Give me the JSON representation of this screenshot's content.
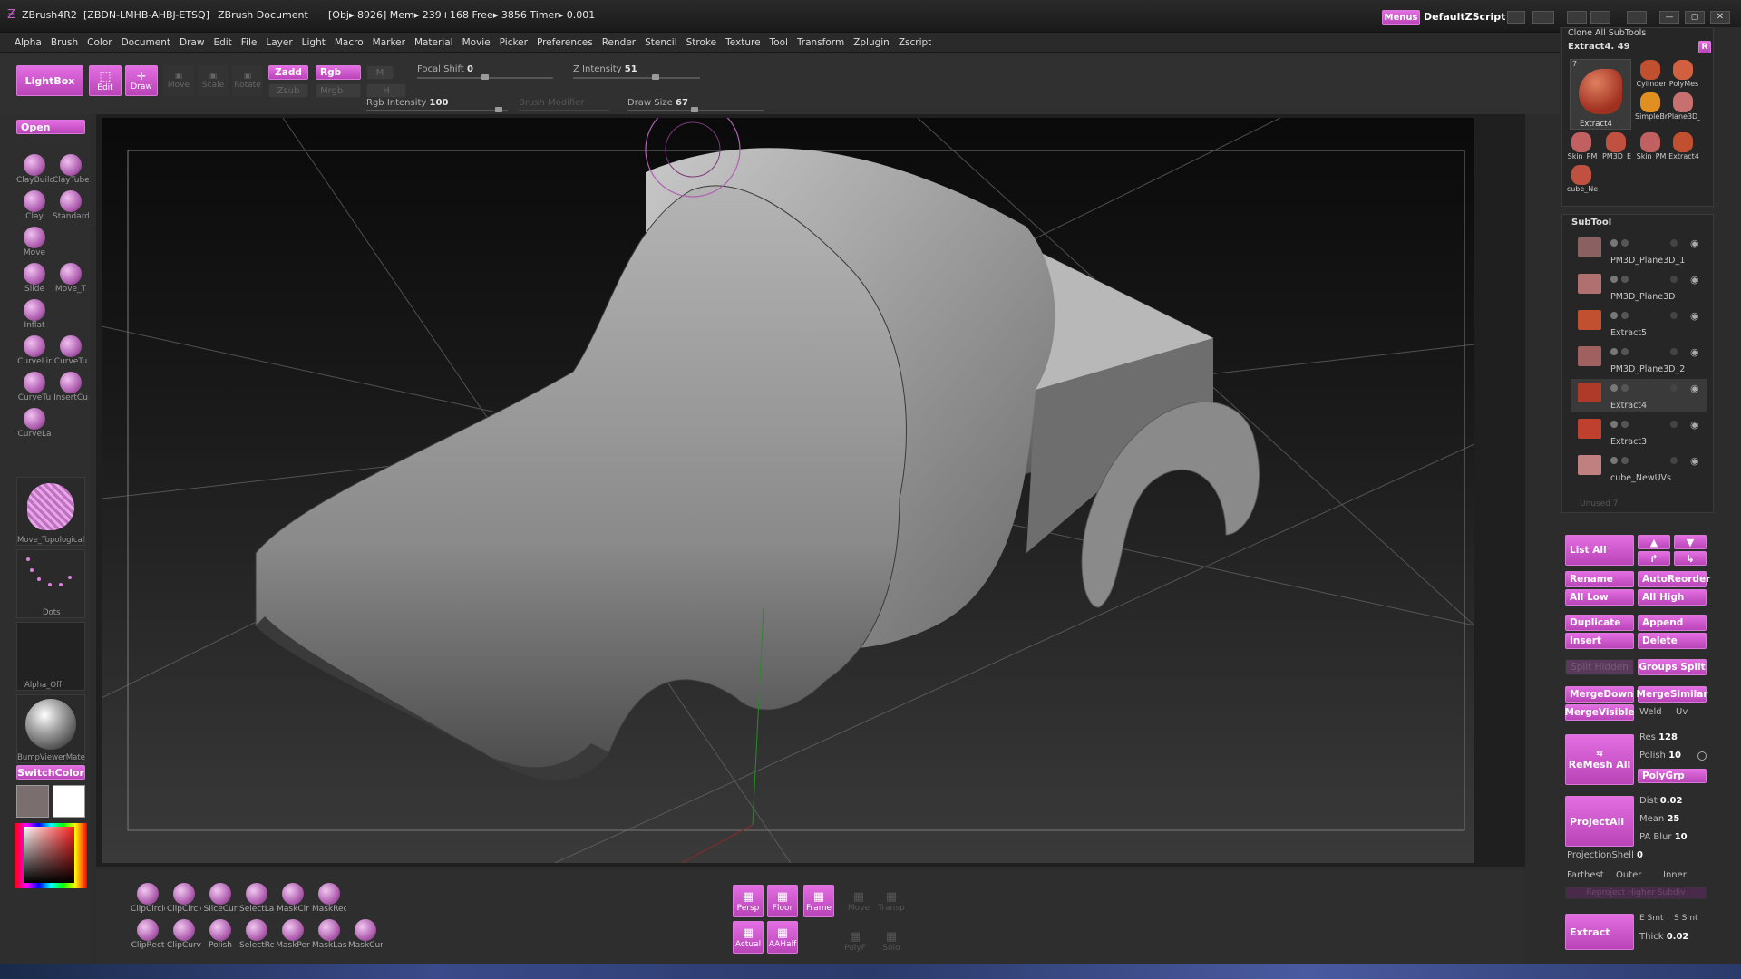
{
  "title_bar": {
    "app": "ZBrush4R2",
    "session": "[ZBDN-LMHB-AHBJ-ETSQ]",
    "document": "ZBrush Document",
    "status": "[Obj▸ 8926] Mem▸ 239+168 Free▸ 3856 Timer▸ 0.001",
    "menus_label": "Menus",
    "script_label": "DefaultZScript"
  },
  "menu": [
    "Alpha",
    "Brush",
    "Color",
    "Document",
    "Draw",
    "Edit",
    "File",
    "Layer",
    "Light",
    "Macro",
    "Marker",
    "Material",
    "Movie",
    "Picker",
    "Preferences",
    "Render",
    "Stencil",
    "Stroke",
    "Texture",
    "Tool",
    "Transform",
    "Zplugin",
    "Zscript"
  ],
  "top_shelf": {
    "lightbox": "LightBox",
    "edit": "Edit",
    "draw": "Draw",
    "move": "Move",
    "scale": "Scale",
    "rotate": "Rotate",
    "zadd": "Zadd",
    "zsub": "Zsub",
    "rgb": "Rgb",
    "mrgb": "Mrgb",
    "m": "M",
    "focal_shift_label": "Focal Shift",
    "focal_shift": "0",
    "z_intensity_label": "Z Intensity",
    "z_intensity": "51",
    "rgb_intensity_label": "Rgb Intensity",
    "rgb_intensity": "100",
    "brush_modifier": "Brush Modifier",
    "draw_size_label": "Draw Size",
    "draw_size": "67"
  },
  "left_shelf": {
    "open": "Open",
    "brushes": [
      "ClayBuild",
      "ClayTube",
      "Clay",
      "Standard",
      "Move",
      "Slide",
      "Move_T",
      "Inflat",
      "CurveLir",
      "CurveTu",
      "CurveTu",
      "InsertCu",
      "CurveLa"
    ],
    "alpha_labels": [
      "Move_Topological",
      "Dots",
      "Alpha_Off",
      "BumpViewerMate"
    ],
    "switch_color": "SwitchColor"
  },
  "right_panel": {
    "clone_all": "Clone All SubTools",
    "extract_value": "Extract4. 49",
    "r_btn": "R",
    "tool_thumbs": [
      "Extract4",
      "Cylinder",
      "PolyMes",
      "SimpleBr",
      "Plane3D_",
      "Skin_PM",
      "PM3D_E",
      "Skin_PM",
      "Extract4",
      "cube_Ne"
    ],
    "tool_count": "7",
    "subtool_title": "SubTool",
    "subtools": [
      "PM3D_Plane3D_1",
      "PM3D_Plane3D",
      "Extract5",
      "PM3D_Plane3D_2",
      "Extract4",
      "Extract3",
      "cube_NewUVs"
    ],
    "unused": "Unused 7",
    "list_all": "List All",
    "rename": "Rename",
    "auto_reorder": "AutoReorder",
    "all_low": "All Low",
    "all_high": "All High",
    "duplicate": "Duplicate",
    "append": "Append",
    "insert": "Insert",
    "delete": "Delete",
    "split_hidden": "Split Hidden",
    "groups_split": "Groups Split",
    "merge_down": "MergeDown",
    "merge_similar": "MergeSimilar",
    "merge_visible": "MergeVisible",
    "weld": "Weld",
    "uv": "Uv",
    "remesh_all": "ReMesh All",
    "res_label": "Res",
    "res": "128",
    "polish_label": "Polish",
    "polish": "10",
    "polygrp": "PolyGrp",
    "project_all": "ProjectAll",
    "dist_label": "Dist",
    "dist": "0.02",
    "mean_label": "Mean",
    "mean": "25",
    "pa_blur_label": "PA Blur",
    "pa_blur": "10",
    "projection_shell_label": "ProjectionShell",
    "projection_shell": "0",
    "farthest": "Farthest",
    "outer": "Outer",
    "inner": "Inner",
    "reproject": "Reproject Higher Subdiv",
    "extract": "Extract",
    "e_smt": "E Smt",
    "s_smt": "S Smt",
    "thick_label": "Thick",
    "thick": "0.02"
  },
  "bottom_shelf": {
    "left_tools": [
      "ClipCircle",
      "ClipCircle",
      "SliceCur",
      "SelectLa",
      "MaskCir",
      "MaskRec",
      "ClipRect",
      "ClipCurv",
      "Polish",
      "SelectRe",
      "MaskPer",
      "MaskLas",
      "MaskCur"
    ],
    "center": [
      "Persp",
      "Floor",
      "Frame",
      "Move",
      "Transp",
      "Actual",
      "AAHalf",
      "PolyF",
      "Solo"
    ]
  },
  "colors": {
    "accent": "#c04ec0",
    "bg": "#2c2c2c"
  }
}
